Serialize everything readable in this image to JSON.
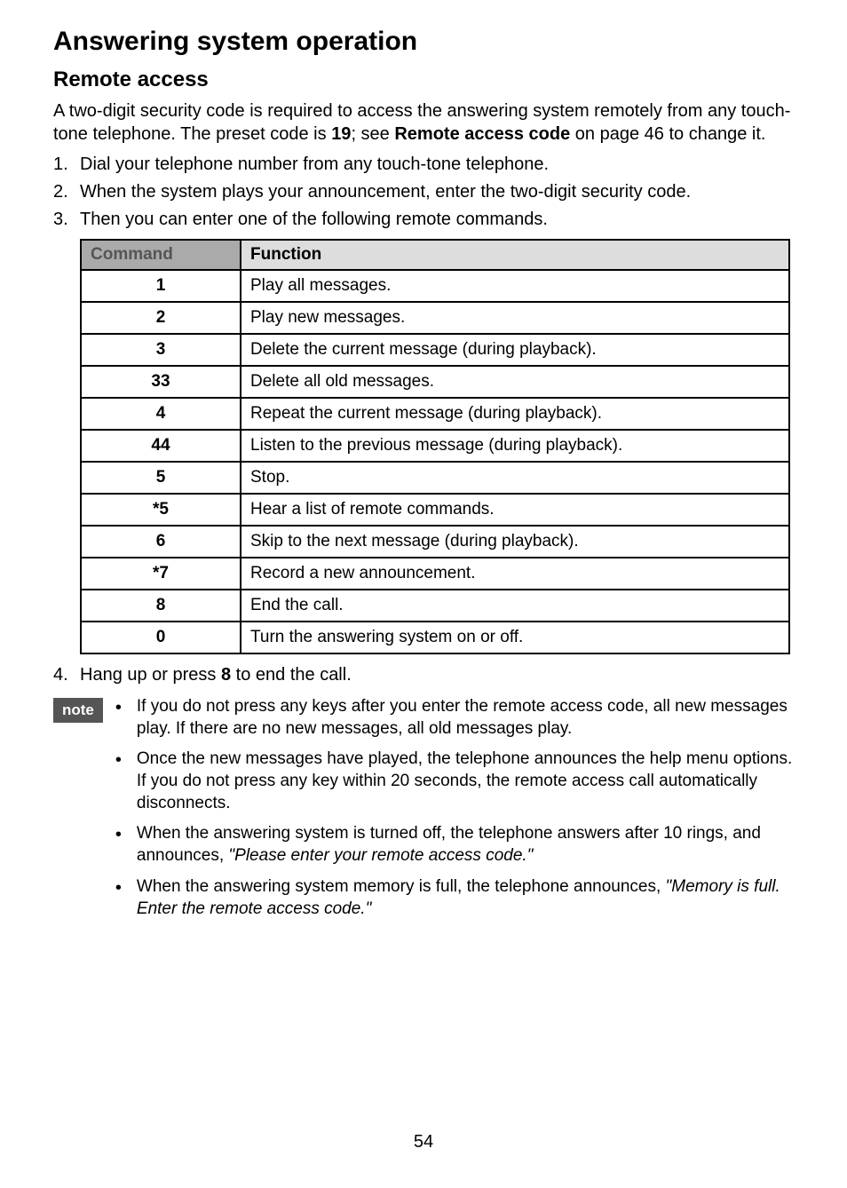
{
  "title": "Answering system operation",
  "section": "Remote access",
  "intro": {
    "line1_a": "A two-digit security code is required to access the answering system remotely from any touch-tone telephone. The preset code is ",
    "preset_code": "19",
    "line1_b": "; see ",
    "ref_bold": "Remote access code",
    "line1_c": " on page 46 to change it."
  },
  "steps": [
    "Dial your telephone number from any touch-tone telephone.",
    "When the system plays your announcement, enter the two-digit security code.",
    "Then you can enter one of the following remote commands."
  ],
  "table": {
    "headers": {
      "cmd": "Command",
      "func": "Function"
    },
    "rows": [
      {
        "cmd": "1",
        "func": "Play all messages."
      },
      {
        "cmd": "2",
        "func": "Play new messages."
      },
      {
        "cmd": "3",
        "func": "Delete the current message (during playback)."
      },
      {
        "cmd": "33",
        "func": "Delete all old messages."
      },
      {
        "cmd": "4",
        "func": "Repeat the current message (during playback)."
      },
      {
        "cmd": "44",
        "func": "Listen to the previous message (during playback)."
      },
      {
        "cmd": "5",
        "func": "Stop."
      },
      {
        "cmd": "*5",
        "func": "Hear a list of remote commands."
      },
      {
        "cmd": "6",
        "func": "Skip to the next message (during playback)."
      },
      {
        "cmd": "*7",
        "func": "Record a new announcement."
      },
      {
        "cmd": "8",
        "func": "End the call."
      },
      {
        "cmd": "0",
        "func": "Turn the answering system on or off."
      }
    ]
  },
  "step4_a": "Hang up or press ",
  "step4_key": "8",
  "step4_b": " to end the call.",
  "note_label": "note",
  "notes": [
    {
      "text": "If you do not press any keys after you enter the remote access code, all new messages play. If there are no new messages, all old messages play."
    },
    {
      "text": "Once the new messages have played, the telephone announces the help menu options. If you do not press any key within 20 seconds, the remote access call automatically disconnects."
    },
    {
      "text": "When the answering system is turned off, the telephone answers after 10 rings, and announces, ",
      "ital": "\"Please enter your remote access code.\""
    },
    {
      "text": "When the answering system memory is full, the telephone announces, ",
      "ital": "\"Memory is full. Enter the remote access code.\""
    }
  ],
  "page_number": "54"
}
